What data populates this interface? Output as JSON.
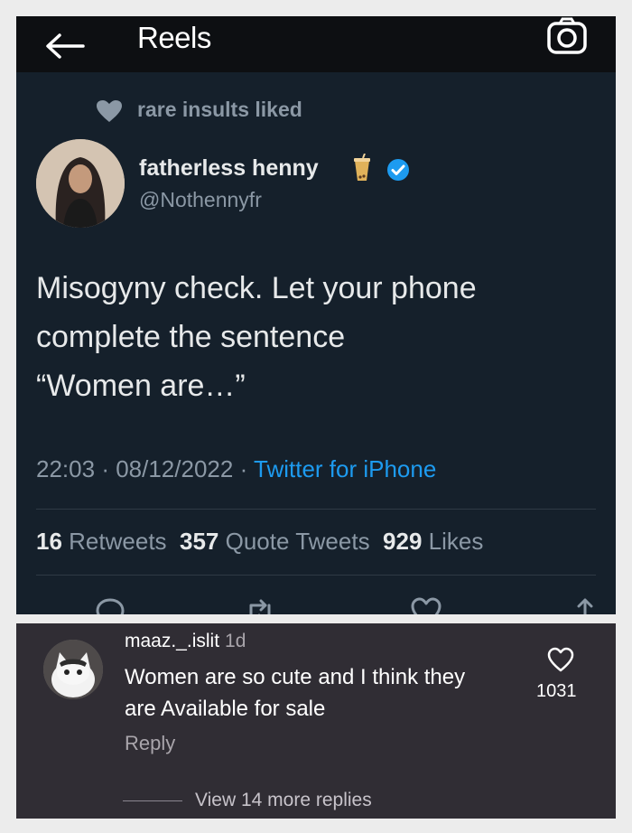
{
  "topbar": {
    "title": "Reels",
    "back_icon": "arrow-left-icon",
    "camera_icon": "camera-icon"
  },
  "tweet": {
    "liked_by": "rare insults liked",
    "display_name": "fatherless henny",
    "handle": "@Nothennyfr",
    "text_lines": [
      "Misogyny check. Let your phone",
      "complete the sentence",
      "“Women are…”"
    ],
    "time": "22:03",
    "date": "08/12/2022",
    "source": "Twitter for iPhone",
    "stats": {
      "retweets": "16",
      "retweets_label": "Retweets",
      "quotes": "357",
      "quotes_label": "Quote Tweets",
      "likes": "929",
      "likes_label": "Likes"
    },
    "actions": [
      "reply-icon",
      "retweet-icon",
      "heart-icon",
      "share-icon"
    ]
  },
  "comment": {
    "username": "maaz._.islit",
    "age": "1d",
    "text_lines": [
      "Women are so cute and I think they",
      "are Available for sale"
    ],
    "reply_label": "Reply",
    "like_count": "1031",
    "view_more": "View 14 more replies"
  },
  "colors": {
    "tweet_bg": "#15202b",
    "link_blue": "#1d9bf0",
    "comment_bg": "#302d34"
  }
}
